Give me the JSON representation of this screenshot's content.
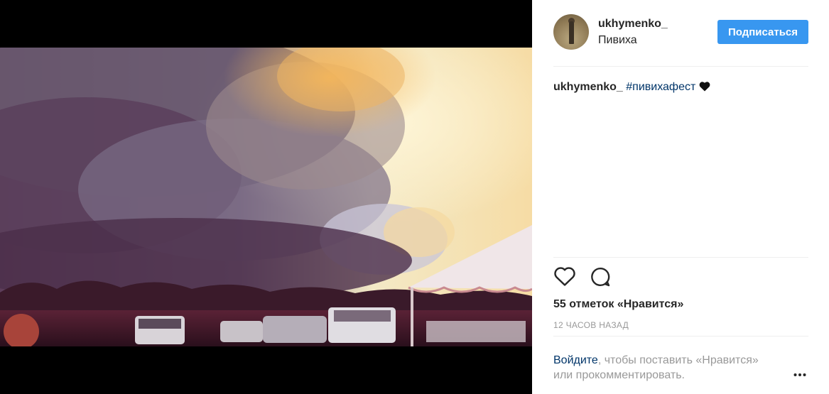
{
  "post": {
    "username": "ukhymenko_",
    "location": "Пивиха",
    "follow_label": "Подписаться",
    "caption": {
      "username": "ukhymenko_",
      "hashtag": "#пивихафест"
    },
    "likes_text": "55 отметок «Нравится»",
    "time_text": "12 ЧАСОВ НАЗАД",
    "login_prompt": {
      "link": "Войдите",
      "rest": ", чтобы поставить «Нравится» или прокомментировать."
    }
  },
  "icons": {
    "like": "heart-outline-icon",
    "comment": "speech-bubble-icon",
    "more": "ellipsis-icon",
    "caption_emoji": "black-heart-icon"
  },
  "colors": {
    "follow_button": "#3897f0",
    "text": "#262626",
    "muted": "#999999",
    "link": "#003569"
  }
}
